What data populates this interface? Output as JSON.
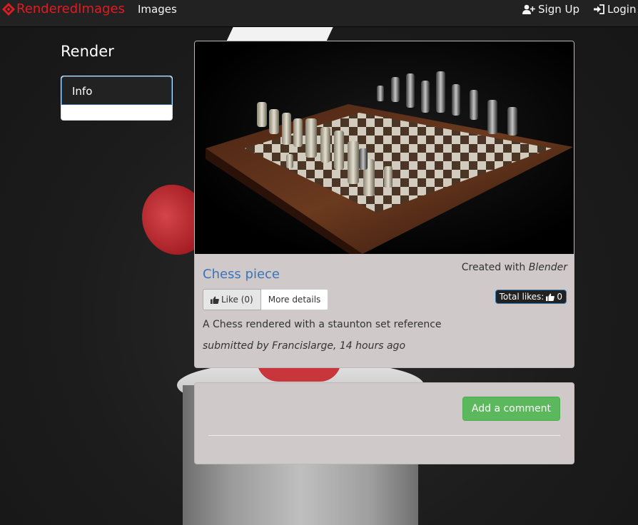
{
  "navbar": {
    "brand": "RenderedImages",
    "images_link": "Images",
    "signup_link": "Sign Up",
    "login_link": "Login"
  },
  "sidebar": {
    "title": "Render",
    "info_item": "Info"
  },
  "render": {
    "title": "Chess piece",
    "created_prefix": "Created with",
    "created_tool": "Blender",
    "like_label": "Like (0)",
    "details_label": "More details",
    "total_likes_label": "Total likes:",
    "total_likes_count": "0",
    "description": "A Chess rendered with a staunton set reference",
    "submitted": "submitted by Francislarge, 14 hours ago"
  },
  "comments": {
    "add_button": "Add a comment"
  },
  "colors": {
    "brand_red": "#e01b22",
    "navbar_bg": "#222222",
    "card_bg": "#cfc9c9",
    "link_blue": "#3a74b8",
    "success_green": "#5cb85c"
  },
  "icons": [
    "brand-logo-icon",
    "user-plus-icon",
    "sign-in-icon",
    "thumbs-up-icon"
  ]
}
